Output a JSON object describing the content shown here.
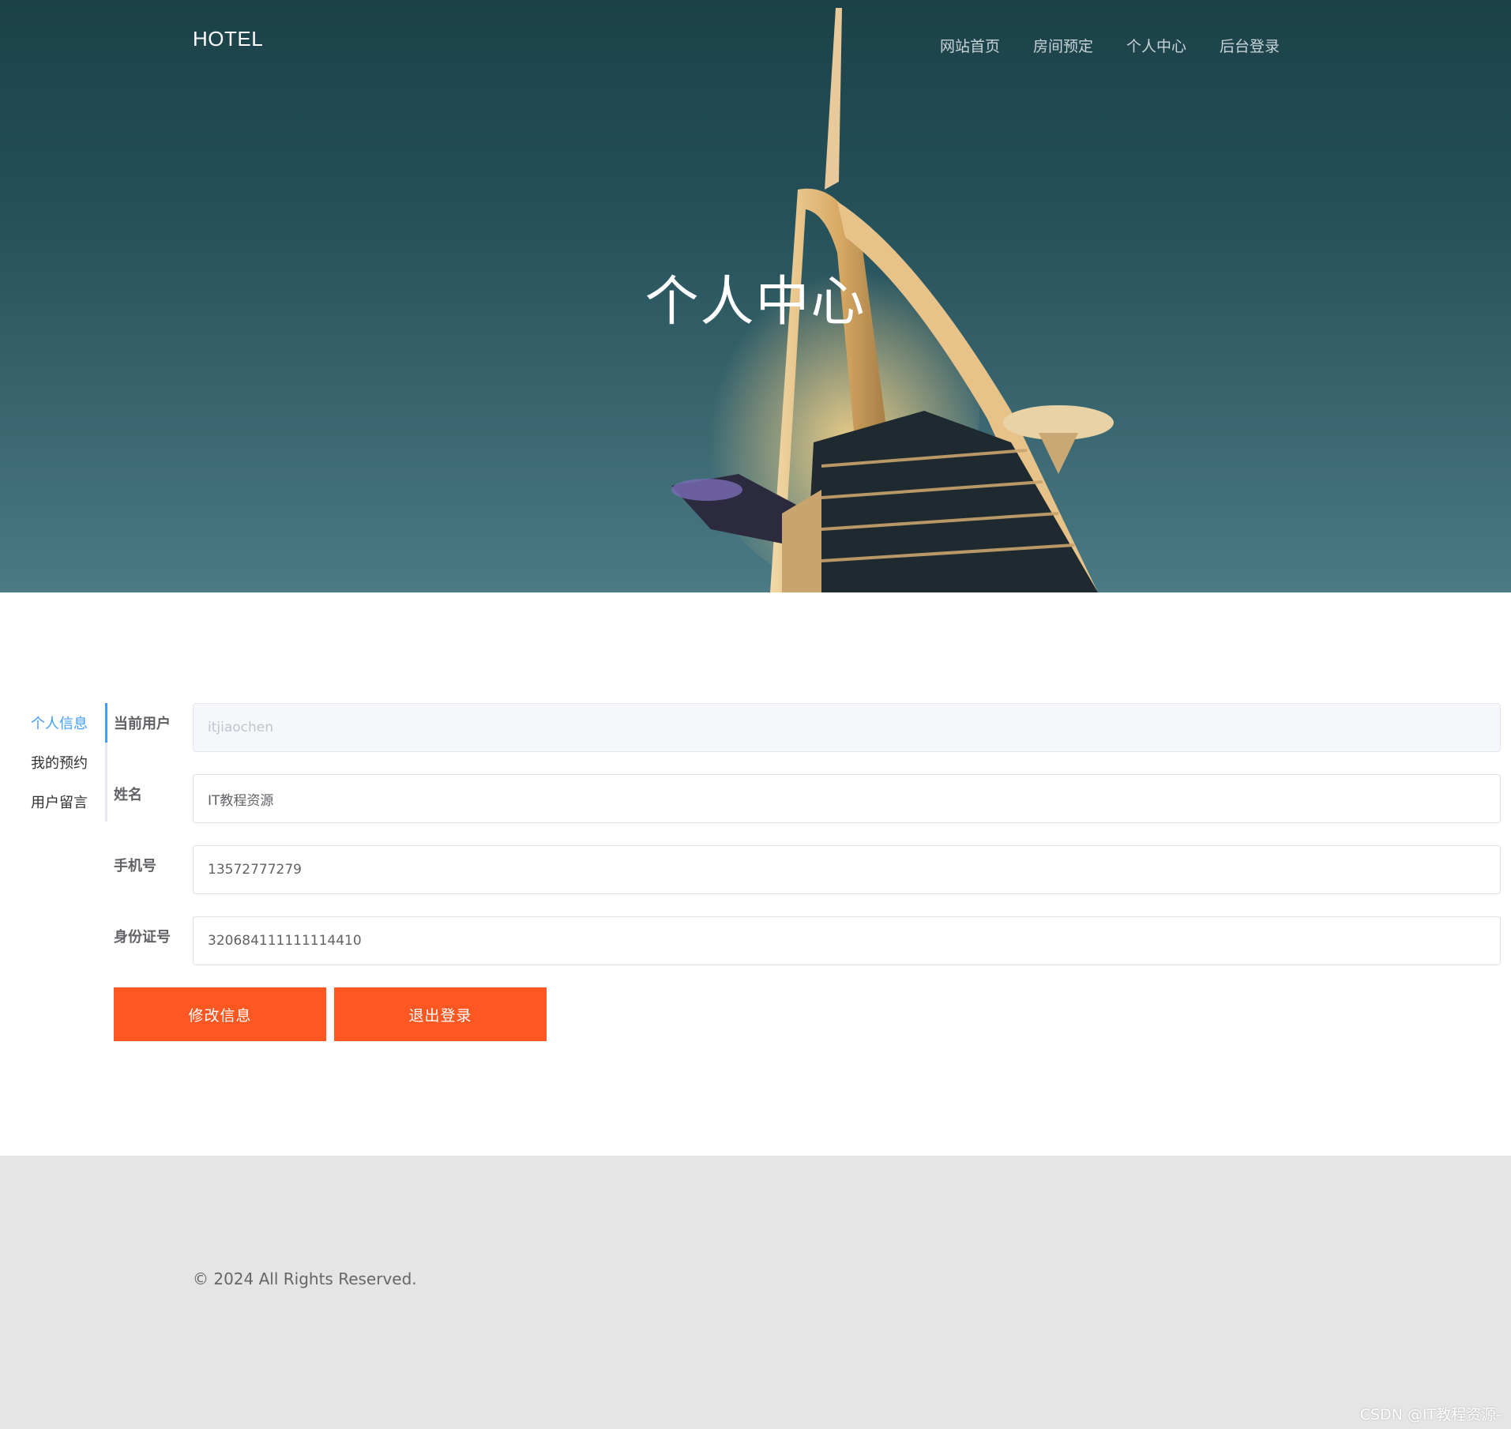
{
  "header": {
    "brand": "HOTEL",
    "nav": [
      {
        "label": "网站首页"
      },
      {
        "label": "房间预定"
      },
      {
        "label": "个人中心"
      },
      {
        "label": "后台登录"
      }
    ]
  },
  "hero": {
    "title": "个人中心"
  },
  "sidebar": {
    "items": [
      {
        "label": "个人信息",
        "active": true
      },
      {
        "label": "我的预约"
      },
      {
        "label": "用户留言"
      }
    ]
  },
  "form": {
    "current_user": {
      "label": "当前用户",
      "value": "itjiaochen"
    },
    "name": {
      "label": "姓名",
      "value": "IT教程资源"
    },
    "phone": {
      "label": "手机号",
      "value": "13572777279"
    },
    "id_number": {
      "label": "身份证号",
      "value": "320684111111114410"
    }
  },
  "buttons": {
    "modify_label": "修改信息",
    "logout_label": "退出登录"
  },
  "footer": {
    "copyright": "© 2024 All Rights Reserved.",
    "watermark": "CSDN @IT教程资源-"
  },
  "colors": {
    "accent_blue": "#409eff",
    "button_orange": "#ff5722",
    "hero_teal": "#24505a",
    "footer_gray": "#e5e5e5"
  }
}
